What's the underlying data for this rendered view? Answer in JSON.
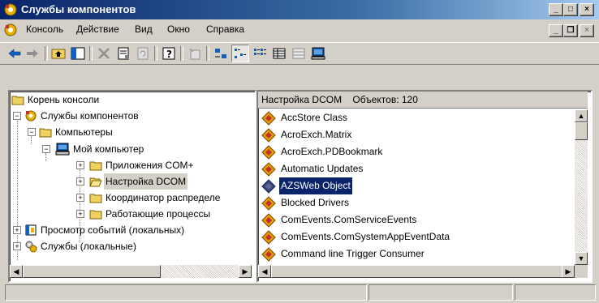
{
  "window": {
    "title": "Службы компонентов",
    "controls": [
      "_",
      "□",
      "×"
    ]
  },
  "menubar": {
    "items": [
      {
        "label": "Консоль"
      },
      {
        "label": "Действие"
      },
      {
        "label": "Вид"
      },
      {
        "label": "Окно"
      },
      {
        "label": "Справка"
      }
    ]
  },
  "tree": {
    "items": [
      {
        "label": "Корень консоли",
        "icon": "folder-icon"
      },
      {
        "label": "Службы компонентов",
        "icon": "component-services-icon"
      },
      {
        "label": "Компьютеры",
        "icon": "folder-icon"
      },
      {
        "label": "Мой компьютер",
        "icon": "computer-icon"
      },
      {
        "label": "Приложения COM+",
        "icon": "folder-icon"
      },
      {
        "label": "Настройка DCOM",
        "icon": "folder-open-icon"
      },
      {
        "label": "Координатор распределе",
        "icon": "folder-icon"
      },
      {
        "label": "Работающие процессы",
        "icon": "folder-icon"
      },
      {
        "label": "Просмотр событий (локальных)",
        "icon": "event-viewer-icon"
      },
      {
        "label": "Службы (локальные)",
        "icon": "services-icon"
      }
    ]
  },
  "right_pane": {
    "header_title": "Настройка DCOM",
    "header_count": "Объектов: 120",
    "items": [
      {
        "label": "AccStore Class"
      },
      {
        "label": "AcroExch.Matrix"
      },
      {
        "label": "AcroExch.PDBookmark"
      },
      {
        "label": "Automatic Updates"
      },
      {
        "label": "AZSWeb Object"
      },
      {
        "label": "Blocked Drivers"
      },
      {
        "label": "ComEvents.ComServiceEvents"
      },
      {
        "label": "ComEvents.ComSystemAppEventData"
      },
      {
        "label": "Command line Trigger Consumer"
      }
    ]
  },
  "colors": {
    "title_start": "#0a246a",
    "title_end": "#a6caf0",
    "selection": "#0a246a",
    "face": "#d4d0c8"
  }
}
